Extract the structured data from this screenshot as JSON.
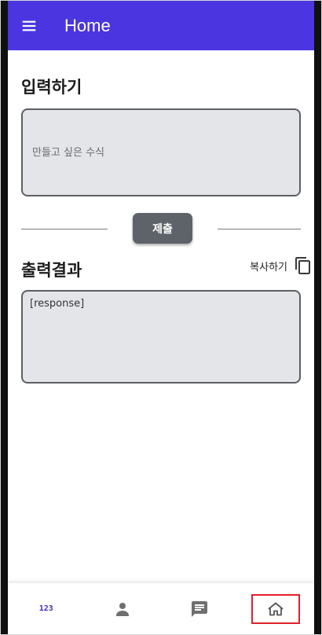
{
  "app_bar": {
    "title": "Home",
    "menu_icon": "hamburger-menu-icon",
    "color": "#4a35e0"
  },
  "input_section": {
    "title": "입력하기",
    "placeholder": "만들고 싶은 수식",
    "value": ""
  },
  "submit_button": {
    "label": "제출"
  },
  "output_section": {
    "title": "출력결과",
    "copy_label": "복사하기",
    "copy_icon": "copy-icon",
    "response": "[response]"
  },
  "bottom_nav": {
    "items": [
      {
        "label": "123",
        "icon": "numbers-icon"
      },
      {
        "icon": "person-icon"
      },
      {
        "icon": "chat-icon"
      },
      {
        "icon": "home-icon",
        "active": true
      }
    ],
    "highlight_color": "#e0202a"
  }
}
